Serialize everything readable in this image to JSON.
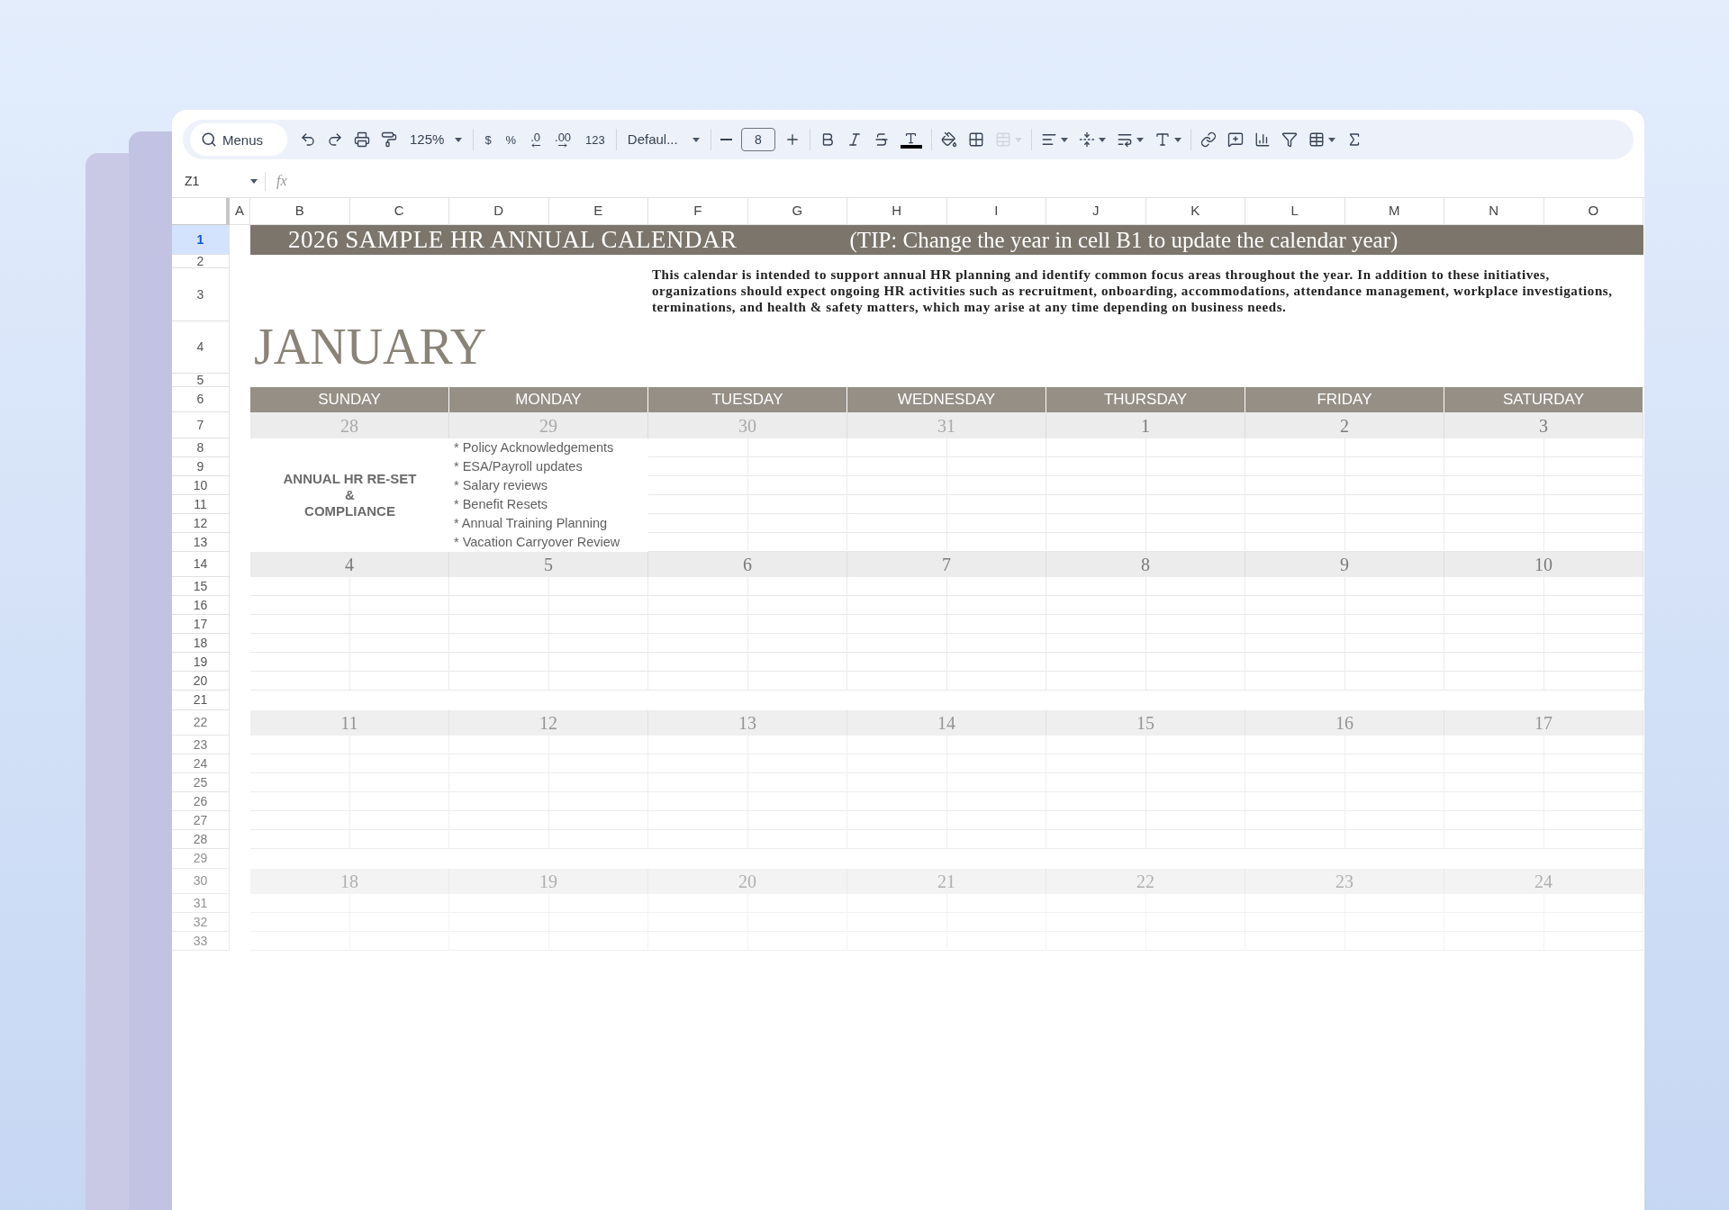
{
  "toolbar": {
    "search": {
      "placeholder": "Menus"
    },
    "zoom": "125%",
    "format_buttons": [
      {
        "kind": "text",
        "label": "$"
      },
      {
        "kind": "text",
        "label": "%"
      },
      {
        "kind": "decrease",
        "label": ".0"
      },
      {
        "kind": "increase",
        "label": ".00"
      },
      {
        "kind": "text",
        "label": "123"
      }
    ],
    "font": "Defaul...",
    "font_size": "8"
  },
  "formula_bar": {
    "name_box": "Z1",
    "fx": "fx"
  },
  "columns": [
    "A",
    "B",
    "C",
    "D",
    "E",
    "F",
    "G",
    "H",
    "I",
    "J",
    "K",
    "L",
    "M",
    "N",
    "O"
  ],
  "row_headers": [
    {
      "label": "1",
      "selected": true
    },
    {
      "label": "2",
      "selected": false
    },
    {
      "label": "3",
      "selected": false
    },
    {
      "label": "4",
      "selected": false
    },
    {
      "label": "5",
      "selected": false
    },
    {
      "label": "6",
      "selected": false
    },
    {
      "label": "7",
      "selected": false
    },
    {
      "label": "8",
      "selected": false
    },
    {
      "label": "9",
      "selected": false
    },
    {
      "label": "10",
      "selected": false
    },
    {
      "label": "11",
      "selected": false
    },
    {
      "label": "12",
      "selected": false
    },
    {
      "label": "13",
      "selected": false
    },
    {
      "label": "14",
      "selected": false
    },
    {
      "label": "15",
      "selected": false
    },
    {
      "label": "16",
      "selected": false
    },
    {
      "label": "17",
      "selected": false
    },
    {
      "label": "18",
      "selected": false
    },
    {
      "label": "19",
      "selected": false
    },
    {
      "label": "20",
      "selected": false
    },
    {
      "label": "21",
      "selected": false
    },
    {
      "label": "22",
      "selected": false
    },
    {
      "label": "23",
      "selected": false
    },
    {
      "label": "24",
      "selected": false
    },
    {
      "label": "25",
      "selected": false
    },
    {
      "label": "26",
      "selected": false
    },
    {
      "label": "27",
      "selected": false
    },
    {
      "label": "28",
      "selected": false
    },
    {
      "label": "29",
      "selected": false
    },
    {
      "label": "30",
      "selected": false
    },
    {
      "label": "31",
      "selected": false
    },
    {
      "label": "32",
      "selected": false
    },
    {
      "label": "33",
      "selected": false
    }
  ],
  "sheet": {
    "title": "2026 SAMPLE HR ANNUAL CALENDAR",
    "tip": "(TIP: Change the year in cell B1 to update the calendar year)",
    "description": "This calendar is intended to support annual HR planning and identify common focus areas throughout the year. In addition to these initiatives, organizations should expect ongoing HR activities such as recruitment, onboarding, accommodations, attendance management, workplace investigations, terminations, and health & safety matters, which may arise at any time depending on business needs.",
    "month": "JANUARY",
    "weekdays": [
      "SUNDAY",
      "MONDAY",
      "TUESDAY",
      "WEDNESDAY",
      "THURSDAY",
      "FRIDAY",
      "SATURDAY"
    ],
    "weeks": [
      {
        "days": [
          {
            "date": "28",
            "in_month": false
          },
          {
            "date": "29",
            "in_month": false
          },
          {
            "date": "30",
            "in_month": false
          },
          {
            "date": "31",
            "in_month": false
          },
          {
            "date": "1",
            "in_month": true
          },
          {
            "date": "2",
            "in_month": true
          },
          {
            "date": "3",
            "in_month": true
          }
        ]
      },
      {
        "days": [
          {
            "date": "4",
            "in_month": true
          },
          {
            "date": "5",
            "in_month": true
          },
          {
            "date": "6",
            "in_month": true
          },
          {
            "date": "7",
            "in_month": true
          },
          {
            "date": "8",
            "in_month": true
          },
          {
            "date": "9",
            "in_month": true
          },
          {
            "date": "10",
            "in_month": true
          }
        ]
      },
      {
        "days": [
          {
            "date": "11",
            "in_month": true
          },
          {
            "date": "12",
            "in_month": true
          },
          {
            "date": "13",
            "in_month": true
          },
          {
            "date": "14",
            "in_month": true
          },
          {
            "date": "15",
            "in_month": true
          },
          {
            "date": "16",
            "in_month": true
          },
          {
            "date": "17",
            "in_month": true
          }
        ]
      },
      {
        "days": [
          {
            "date": "18",
            "in_month": true
          },
          {
            "date": "19",
            "in_month": true
          },
          {
            "date": "20",
            "in_month": true
          },
          {
            "date": "21",
            "in_month": true
          },
          {
            "date": "22",
            "in_month": true
          },
          {
            "date": "23",
            "in_month": true
          },
          {
            "date": "24",
            "in_month": true
          }
        ]
      }
    ],
    "focus_area": "ANNUAL HR RE-SET\n&\nCOMPLIANCE",
    "focus_items": [
      "* Policy Acknowledgements",
      "* ESA/Payroll updates",
      "* Salary reviews",
      "* Benefit Resets",
      "* Annual Training Planning",
      "* Vacation Carryover Review"
    ]
  }
}
